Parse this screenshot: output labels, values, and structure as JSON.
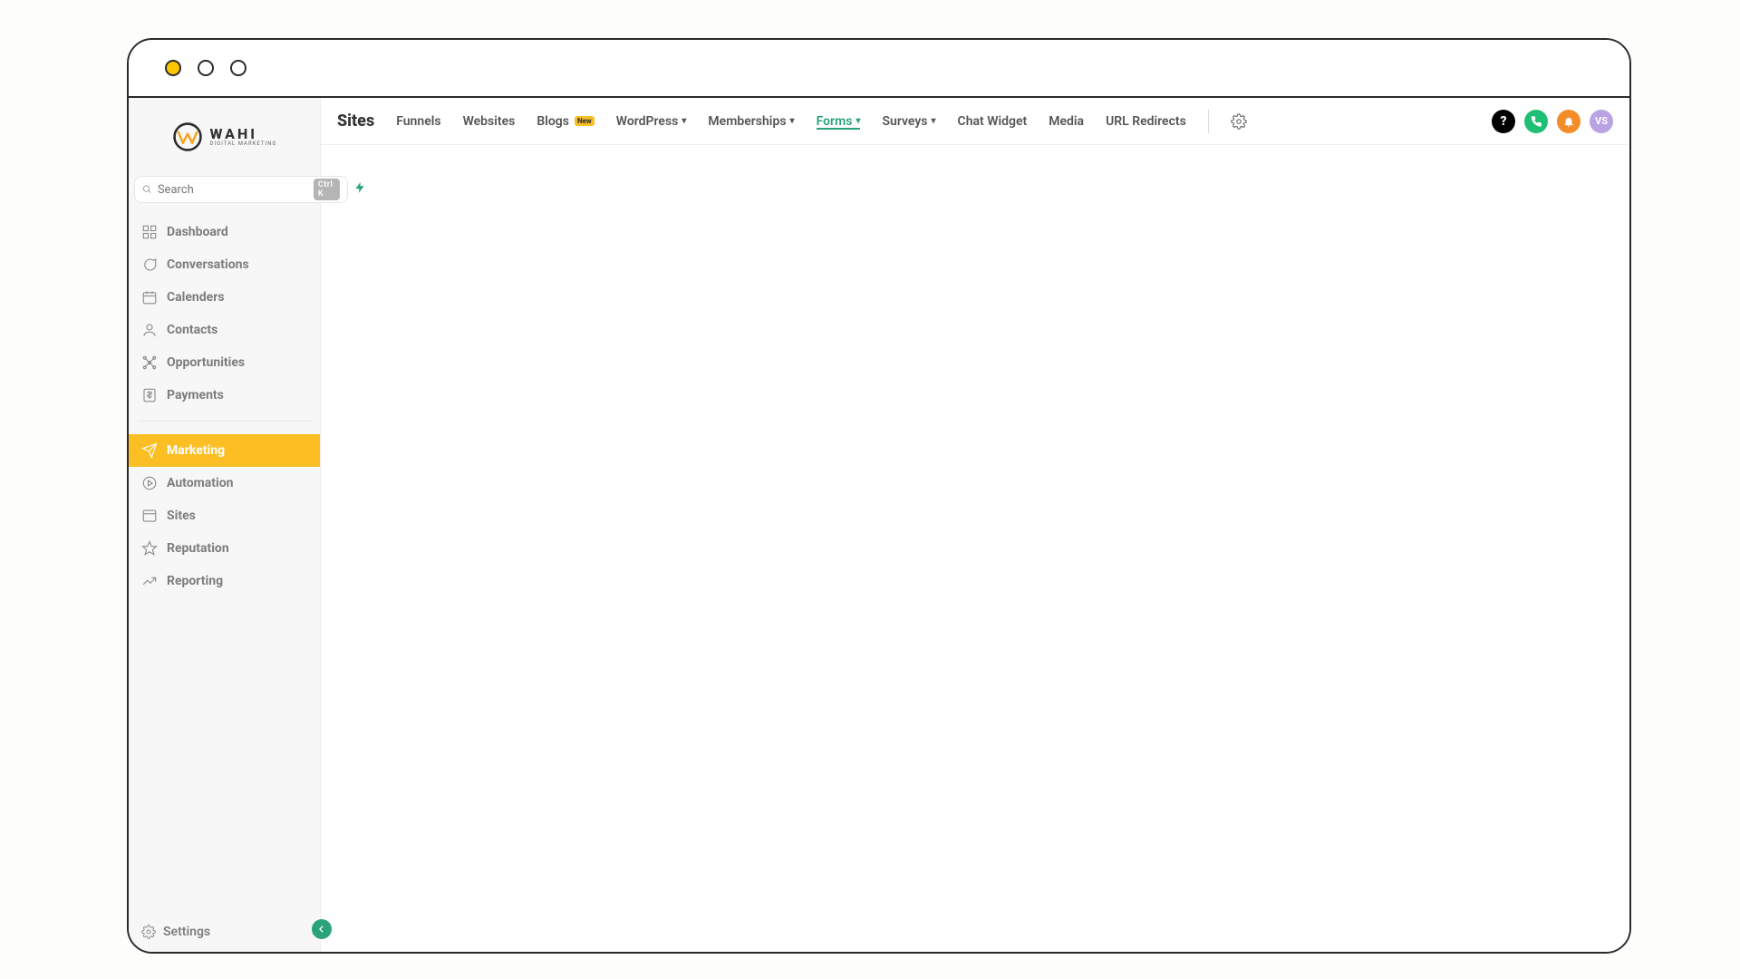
{
  "logo": {
    "brand": "WAHI",
    "tag": "DIGITAL MARKETING"
  },
  "search": {
    "placeholder": "Search",
    "shortcut": "Ctrl K"
  },
  "sidebar": {
    "items": [
      {
        "label": "Dashboard"
      },
      {
        "label": "Conversations"
      },
      {
        "label": "Calenders"
      },
      {
        "label": "Contacts"
      },
      {
        "label": "Opportunities"
      },
      {
        "label": "Payments"
      }
    ],
    "items2": [
      {
        "label": "Marketing"
      },
      {
        "label": "Automation"
      },
      {
        "label": "Sites"
      },
      {
        "label": "Reputation"
      },
      {
        "label": "Reporting"
      }
    ],
    "settings": "Settings"
  },
  "topnav": {
    "title": "Sites",
    "tabs": [
      {
        "label": "Funnels"
      },
      {
        "label": "Websites"
      },
      {
        "label": "Blogs",
        "badge": "New"
      },
      {
        "label": "WordPress",
        "dropdown": true
      },
      {
        "label": "Memberships",
        "dropdown": true
      },
      {
        "label": "Forms",
        "dropdown": true,
        "active": true
      },
      {
        "label": "Surveys",
        "dropdown": true
      },
      {
        "label": "Chat Widget"
      },
      {
        "label": "Media"
      },
      {
        "label": "URL Redirects"
      }
    ]
  },
  "user": {
    "initials": "VS"
  },
  "help": {
    "glyph": "?"
  }
}
